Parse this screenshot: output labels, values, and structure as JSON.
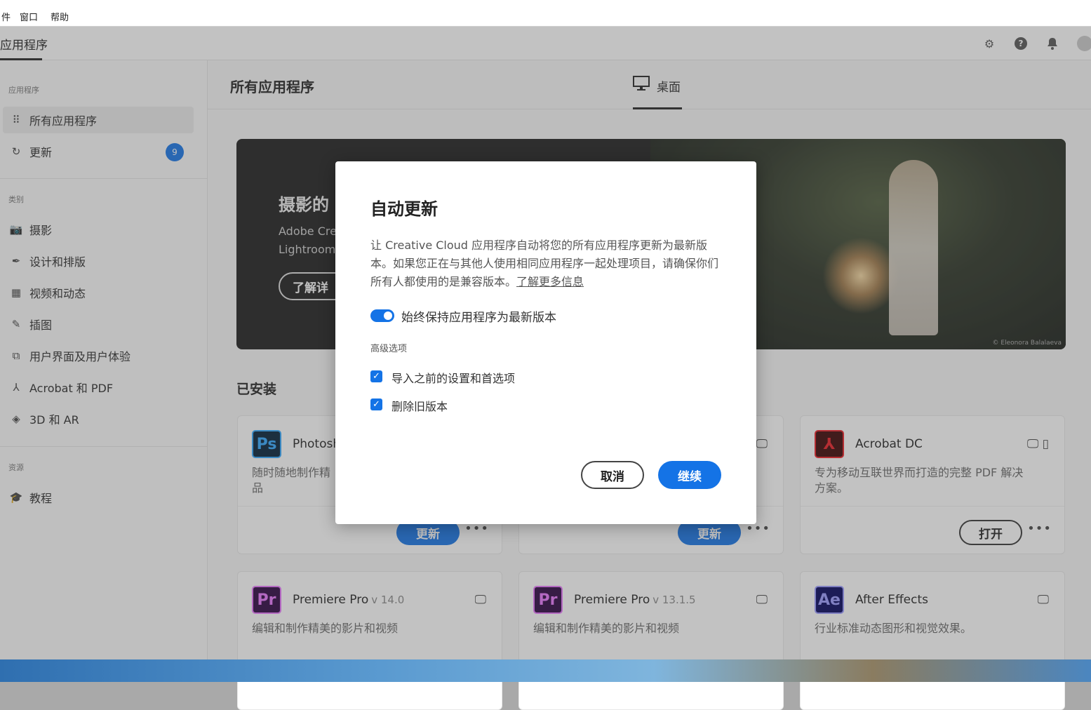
{
  "menubar": {
    "items": [
      "件",
      "窗口",
      "帮助"
    ]
  },
  "header": {
    "title": "应用程序",
    "icons": [
      "gear-icon",
      "help-icon",
      "bell-icon",
      "avatar-icon"
    ]
  },
  "sidebar": {
    "sections": [
      "应用程序",
      "类别",
      "资源"
    ],
    "apps": [
      {
        "icon": "grid-icon",
        "label": "所有应用程序"
      },
      {
        "icon": "refresh-icon",
        "label": "更新",
        "badge": "9"
      }
    ],
    "categories": [
      {
        "icon": "camera-icon",
        "label": "摄影"
      },
      {
        "icon": "pen-tool-icon",
        "label": "设计和排版"
      },
      {
        "icon": "film-icon",
        "label": "视频和动态"
      },
      {
        "icon": "brush-icon",
        "label": "插图"
      },
      {
        "icon": "ui-ux-icon",
        "label": "用户界面及用户体验"
      },
      {
        "icon": "acrobat-icon",
        "label": "Acrobat 和 PDF"
      },
      {
        "icon": "cube-icon",
        "label": "3D 和 AR"
      }
    ],
    "resources": [
      {
        "icon": "graduation-cap-icon",
        "label": "教程"
      }
    ]
  },
  "main": {
    "title": "所有应用程序",
    "tab": {
      "icon": "desktop-icon",
      "label": "桌面"
    },
    "banner": {
      "title": "摄影的",
      "line1": "Adobe Crea",
      "line2": "Lightroom",
      "button": "了解详",
      "credit": "© Eleonora Balalaeva"
    },
    "installed_label": "已安装",
    "cards": [
      {
        "logo": "Ps",
        "name": "Photosh",
        "version": "",
        "desc": "随时随地制作精",
        "desc2": "品",
        "action": "更新",
        "more": "•••"
      },
      {
        "logo": "",
        "name": "",
        "version": "",
        "desc": "",
        "desc2": "",
        "action": "更新",
        "more": "•••"
      },
      {
        "logo": "Acrobat-logo",
        "name": "Acrobat DC",
        "version": "",
        "desc": "专为移动互联世界而打造的完整 PDF 解决方案。",
        "desc2": "",
        "action": "打开",
        "more": "•••"
      },
      {
        "logo": "Pr",
        "name": "Premiere Pro",
        "version": "v 14.0",
        "desc": "编辑和制作精美的影片和视频",
        "desc2": ""
      },
      {
        "logo": "Pr",
        "name": "Premiere Pro",
        "version": "v 13.1.5",
        "desc": "编辑和制作精美的影片和视频",
        "desc2": ""
      },
      {
        "logo": "Ae",
        "name": "After Effects",
        "version": "",
        "desc": "行业标准动态图形和视觉效果。",
        "desc2": ""
      }
    ]
  },
  "dialog": {
    "title": "自动更新",
    "desc": "让 Creative Cloud 应用程序自动将您的所有应用程序更新为最新版本。如果您正在与其他人使用相同应用程序一起处理项目，请确保你们所有人都使用的是兼容版本。",
    "link": "了解更多信息",
    "toggle_label": "始终保持应用程序为最新版本",
    "toggle_on": true,
    "advanced_label": "高级选项",
    "opt1": "导入之前的设置和首选项",
    "opt2": "删除旧版本",
    "cancel": "取消",
    "continue": "继续"
  },
  "colors": {
    "accent": "#1473e6",
    "ps": "#31a8ff",
    "pr": "#ea77ff",
    "ae": "#9999ff",
    "acrobat": "#ec1c24"
  }
}
